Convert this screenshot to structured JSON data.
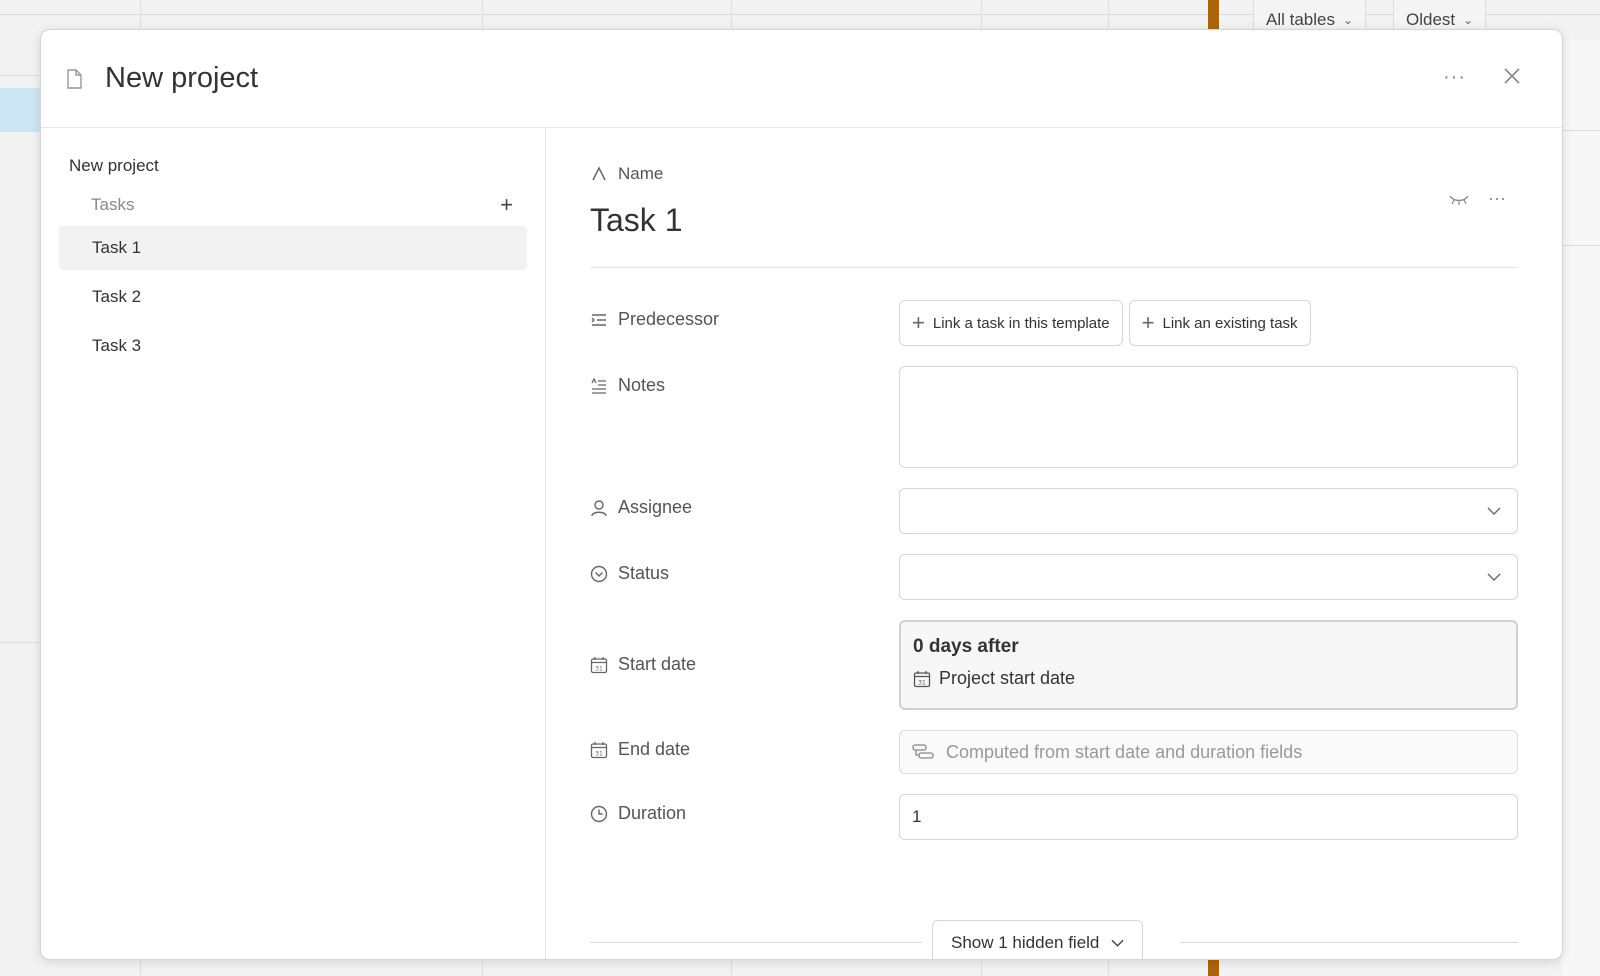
{
  "background": {
    "filters": [
      {
        "label": "All tables"
      },
      {
        "label": "Oldest"
      }
    ],
    "accent_color": "#a8650d"
  },
  "modal": {
    "title": "New project",
    "more_label": "···"
  },
  "sidebar": {
    "project": "New project",
    "section_label": "Tasks",
    "add_label": "+",
    "items": [
      {
        "label": "Task 1",
        "active": true
      },
      {
        "label": "Task 2",
        "active": false
      },
      {
        "label": "Task 3",
        "active": false
      }
    ]
  },
  "task": {
    "name_label": "Name",
    "title": "Task 1",
    "more_label": "···",
    "fields": {
      "predecessor": {
        "label": "Predecessor",
        "buttons": [
          {
            "label": "Link a task in this template"
          },
          {
            "label": "Link an existing task"
          }
        ]
      },
      "notes": {
        "label": "Notes",
        "value": ""
      },
      "assignee": {
        "label": "Assignee",
        "value": ""
      },
      "status": {
        "label": "Status",
        "value": ""
      },
      "start_date": {
        "label": "Start date",
        "offset": "0 days after",
        "reference": "Project start date"
      },
      "end_date": {
        "label": "End date",
        "placeholder": "Computed from start date and duration fields"
      },
      "duration": {
        "label": "Duration",
        "value": "1"
      }
    },
    "hidden_button": "Show 1 hidden field"
  }
}
